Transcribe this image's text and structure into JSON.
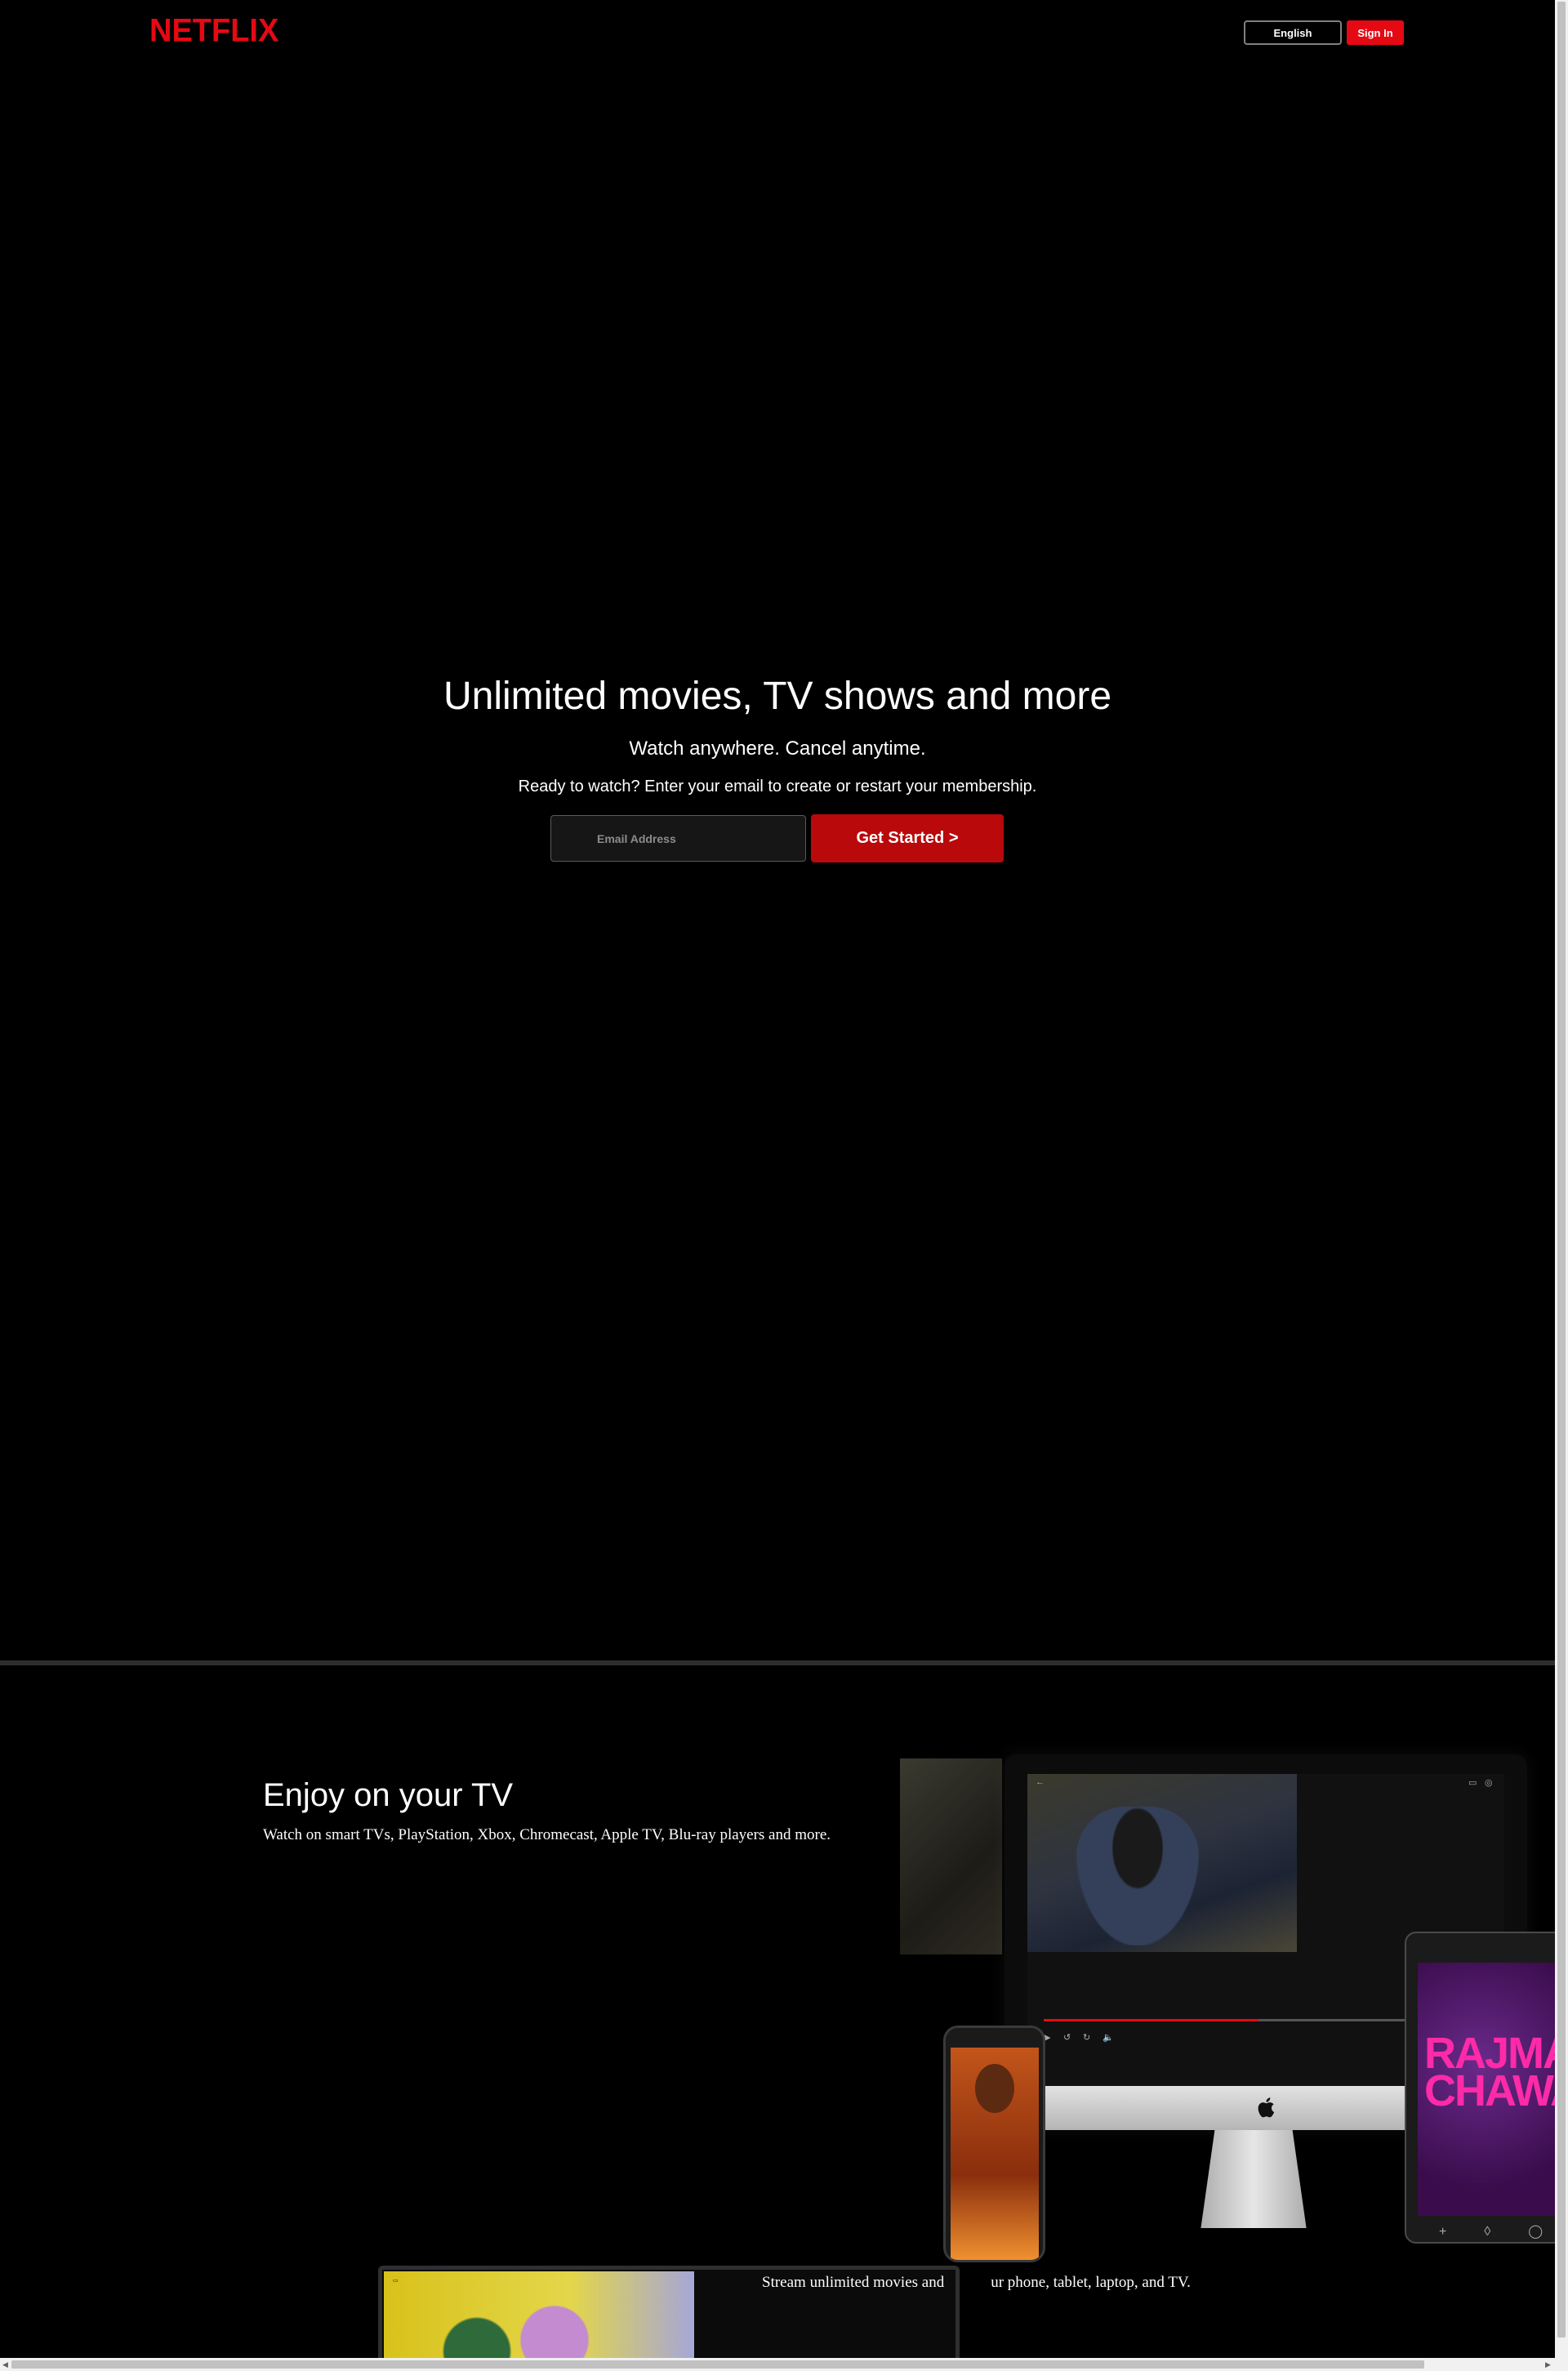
{
  "header": {
    "logo_text": "NETFLIX",
    "language_label": "English",
    "signin_label": "Sign In"
  },
  "hero": {
    "title": "Unlimited movies, TV shows and more",
    "subtitle": "Watch anywhere. Cancel anytime.",
    "cta_text": "Ready to watch? Enter your email to create or restart your membership.",
    "email_placeholder": "Email Address",
    "get_started_label": "Get Started >"
  },
  "feature_tv": {
    "title": "Enjoy on your TV",
    "description": "Watch on smart TVs, PlayStation, Xbox, Chromecast, Apple TV, Blu-ray players and more.",
    "tablet_title": "RAJMA CHAWAL",
    "video_progress": 0.48
  },
  "feature_stream": {
    "text": "Stream unlimited movies and            ur phone, tablet, laptop, and TV."
  },
  "colors": {
    "brand_red": "#e50914",
    "cta_red": "#b9090b",
    "background": "#000000"
  },
  "icons": {
    "logo": "netflix-logo",
    "apple": "apple-icon",
    "back": "back-arrow-icon",
    "cast": "cast-icon"
  }
}
